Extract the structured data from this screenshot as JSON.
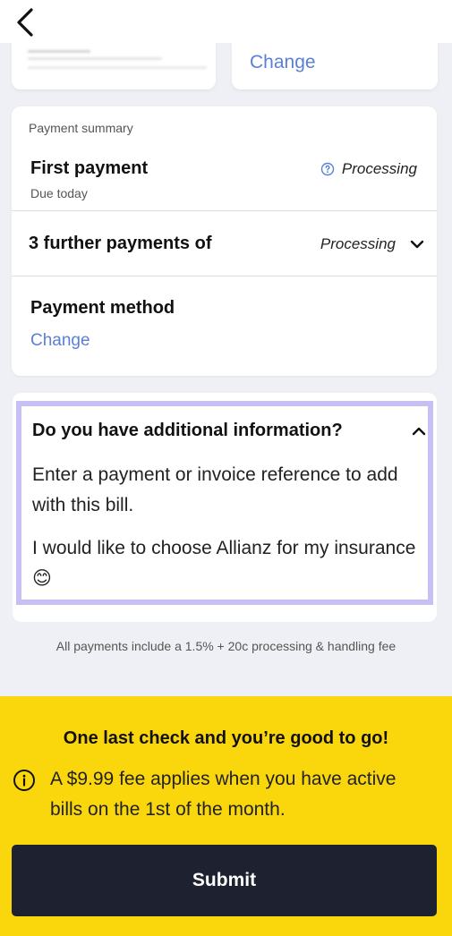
{
  "top_cards": {
    "change_label": "Change"
  },
  "summary": {
    "section_label": "Payment summary",
    "first_payment": {
      "title": "First payment",
      "subtitle": "Due today",
      "status": "Processing"
    },
    "further_payments": {
      "title": "3 further payments of",
      "status": "Processing"
    },
    "payment_method": {
      "title": "Payment method",
      "change_label": "Change"
    }
  },
  "additional_info": {
    "heading": "Do you have additional information?",
    "prompt": "Enter a payment or invoice reference to add with this bill.",
    "value": "I would like to choose Allianz for my insurance 😊"
  },
  "fee_note": "All payments include a 1.5% + 20c processing & handling fee",
  "bottom": {
    "title": "One last check and you’re good to go!",
    "alert": "A $9.99 fee applies when you have active bills on the 1st of the month.",
    "submit_label": "Submit"
  },
  "colors": {
    "accent_yellow": "#fad70c",
    "link_blue": "#5b7fd6",
    "highlight_purple": "#c6c0f4",
    "button_dark": "#1e2230"
  }
}
